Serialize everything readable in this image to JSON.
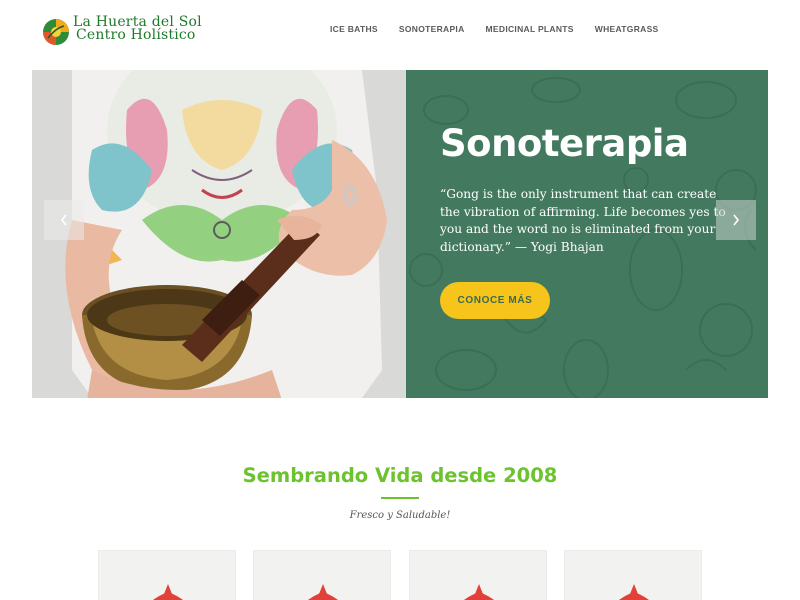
{
  "brand": {
    "line1": "La Huerta del Sol",
    "line2": "Centro Holístico"
  },
  "nav": {
    "items": [
      "ICE BATHS",
      "SONOTERAPIA",
      "MEDICINAL PLANTS",
      "WHEATGRASS"
    ]
  },
  "slider": {
    "title": "Sonoterapia",
    "quote": "“Gong is the only instrument that can create the vibration of affirming. Life becomes yes to you and the word no is eliminated from your dictionary.” — Yogi Bhajan",
    "cta_label": "CONOCE MÁS",
    "prev_icon": "chevron-left-icon",
    "next_icon": "chevron-right-icon",
    "panel_color": "#437a5f",
    "cta_color": "#f6c41a"
  },
  "intro": {
    "title": "Sembrando Vida desde 2008",
    "subtitle": "Fresco y Saludable!",
    "accent": "#6cc32d"
  },
  "cards": [
    {
      "icon": "mandala-icon"
    },
    {
      "icon": "mandala-icon"
    },
    {
      "icon": "mandala-icon"
    },
    {
      "icon": "mandala-icon"
    }
  ]
}
